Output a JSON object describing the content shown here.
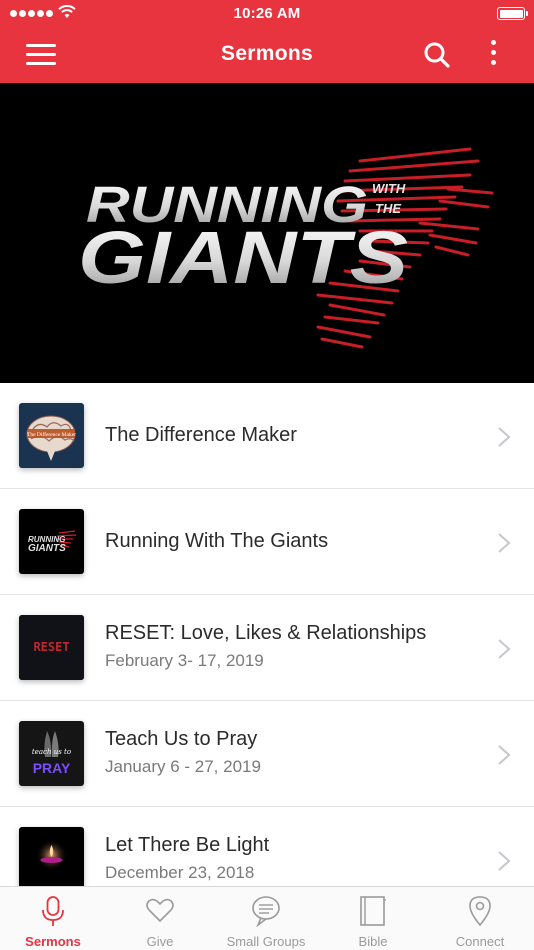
{
  "status_bar": {
    "time": "10:26 AM"
  },
  "header": {
    "title": "Sermons"
  },
  "hero": {
    "line1": "RUNNING",
    "line2": "GIANTS",
    "small1": "WITH",
    "small2": "THE"
  },
  "sermons": [
    {
      "title": "The Difference Maker",
      "subtitle": "",
      "thumb": "brain",
      "thumb_text": "The Difference Maker"
    },
    {
      "title": "Running With The Giants",
      "subtitle": "",
      "thumb": "giants",
      "thumb_text": "RUNNING GIANTS"
    },
    {
      "title": "RESET: Love, Likes & Relationships",
      "subtitle": "February 3- 17, 2019",
      "thumb": "reset",
      "thumb_text": "RESET"
    },
    {
      "title": "Teach Us to Pray",
      "subtitle": "January 6 - 27, 2019",
      "thumb": "pray",
      "thumb_text_small": "teach us to",
      "thumb_text": "PRAY"
    },
    {
      "title": "Let There Be Light",
      "subtitle": "December 23, 2018",
      "thumb": "light",
      "thumb_text": ""
    }
  ],
  "tabs": [
    {
      "label": "Sermons",
      "icon": "microphone-icon",
      "active": true
    },
    {
      "label": "Give",
      "icon": "heart-icon",
      "active": false
    },
    {
      "label": "Small Groups",
      "icon": "chat-bubbles-icon",
      "active": false
    },
    {
      "label": "Bible",
      "icon": "book-icon",
      "active": false
    },
    {
      "label": "Connect",
      "icon": "location-pin-icon",
      "active": false
    }
  ],
  "colors": {
    "brand": "#e7343f",
    "tab_inactive": "#9a9a9a"
  }
}
